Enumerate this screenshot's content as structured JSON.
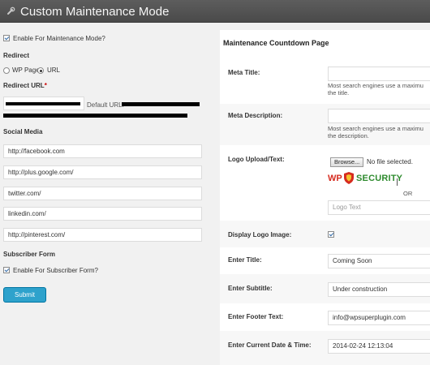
{
  "app": {
    "title": "Custom Maintenance Mode"
  },
  "left": {
    "enable_label": "Enable For Maintenance Mode?",
    "redirect_heading": "Redirect",
    "redirect_wp_page": "WP Page",
    "redirect_url": "URL",
    "redirect_url_heading": "Redirect URL",
    "required_mark": "*",
    "default_url_label": "Default URL:",
    "social_heading": "Social Media",
    "social": [
      {
        "value": "http://facebook.com"
      },
      {
        "value": "http://plus.google.com/"
      },
      {
        "value": "twitter.com/"
      },
      {
        "value": "linkedin.com/"
      },
      {
        "value": "http://pinterest.com/"
      }
    ],
    "subscriber_heading": "Subscriber Form",
    "subscriber_label": "Enable For Subscriber Form?",
    "submit_label": "Submit"
  },
  "right": {
    "heading": "Maintenance Countdown Page",
    "meta_title_label": "Meta Title:",
    "meta_title_help_1": "Most search engines use a maximu",
    "meta_title_help_2": "the title.",
    "meta_desc_label": "Meta Description:",
    "meta_desc_help_1": "Most search engines use a maximu",
    "meta_desc_help_2": "the description.",
    "logo_label": "Logo Upload/Text:",
    "browse_label": "Browse...",
    "no_file": "No file selected.",
    "logo_wp": "WP",
    "logo_security": "SECURITY",
    "or_text": "OR",
    "logo_text_placeholder": "Logo Text",
    "display_logo_label": "Display Logo Image:",
    "enter_title_label": "Enter Title:",
    "enter_title_value": "Coming Soon",
    "enter_subtitle_label": "Enter Subtitle:",
    "enter_subtitle_value": "Under construction",
    "footer_label": "Enter Footer Text:",
    "footer_value": "info@wpsuperplugin.com",
    "date_label": "Enter Current Date & Time:",
    "date_value": "2014-02-24 12:13:04"
  },
  "colors": {
    "titlebar": "#4f4f4f",
    "submit": "#2ea2cc",
    "logo_red": "#d62b1f",
    "logo_green": "#2e8b2e"
  }
}
